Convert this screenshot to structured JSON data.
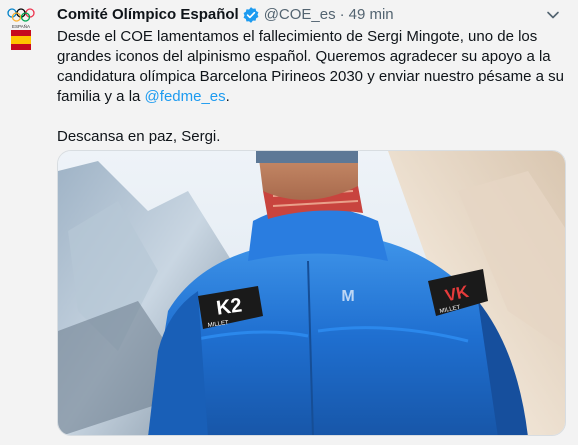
{
  "account": {
    "display_name": "Comité Olímpico Español",
    "handle": "@COE_es",
    "separator": "·",
    "time": "49 min",
    "avatar_text": "ESPAÑA"
  },
  "tweet": {
    "line1": "Desde el COE lamentamos el fallecimiento de Sergi Mingote, uno de los grandes iconos del alpinismo español. Queremos agradecer su apoyo a la candidatura olímpica Barcelona Pirineos 2030 y enviar nuestro pésame a su familia y a la ",
    "mention": "@fedme_es",
    "line1_end": ".",
    "line2": "Descansa en paz, Sergi."
  },
  "media": {
    "patch_right_text": "VK",
    "patch_left_text": "K2",
    "patch_left_sub": "MILLET",
    "patch_right_sub": "MILLET",
    "logo": "M"
  },
  "colors": {
    "accent": "#1d9bf0",
    "verified": "#1d9bf0",
    "jacket": "#1f6fd0",
    "background": "#f3f3f3"
  },
  "icons": {
    "verified": "verified-badge-icon",
    "more": "chevron-down-icon"
  }
}
